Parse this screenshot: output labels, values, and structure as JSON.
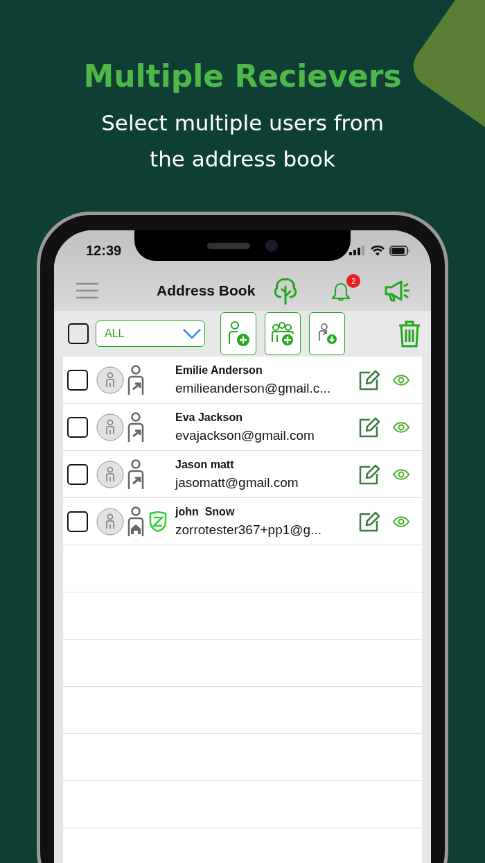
{
  "headline": "Multiple Recievers",
  "subtitle": "Select multiple users from the address book",
  "status_bar": {
    "time": "12:39"
  },
  "header": {
    "title": "Address Book",
    "notification_count": "2"
  },
  "toolbar": {
    "select_all_checked": false,
    "filter": "ALL"
  },
  "contacts": [
    {
      "name": "Emilie Anderson",
      "email": "emilieanderson@gmail.c...",
      "checked": false,
      "kind": "outgoing",
      "badge": false
    },
    {
      "name": "Eva Jackson",
      "email": "evajackson@gmail.com",
      "checked": false,
      "kind": "outgoing",
      "badge": false
    },
    {
      "name": "Jason matt",
      "email": "jasomatt@gmail.com",
      "checked": false,
      "kind": "outgoing",
      "badge": false
    },
    {
      "name": "john  Snow",
      "email": "zorrotester367+pp1@g...",
      "checked": false,
      "kind": "home",
      "badge": true
    }
  ]
}
